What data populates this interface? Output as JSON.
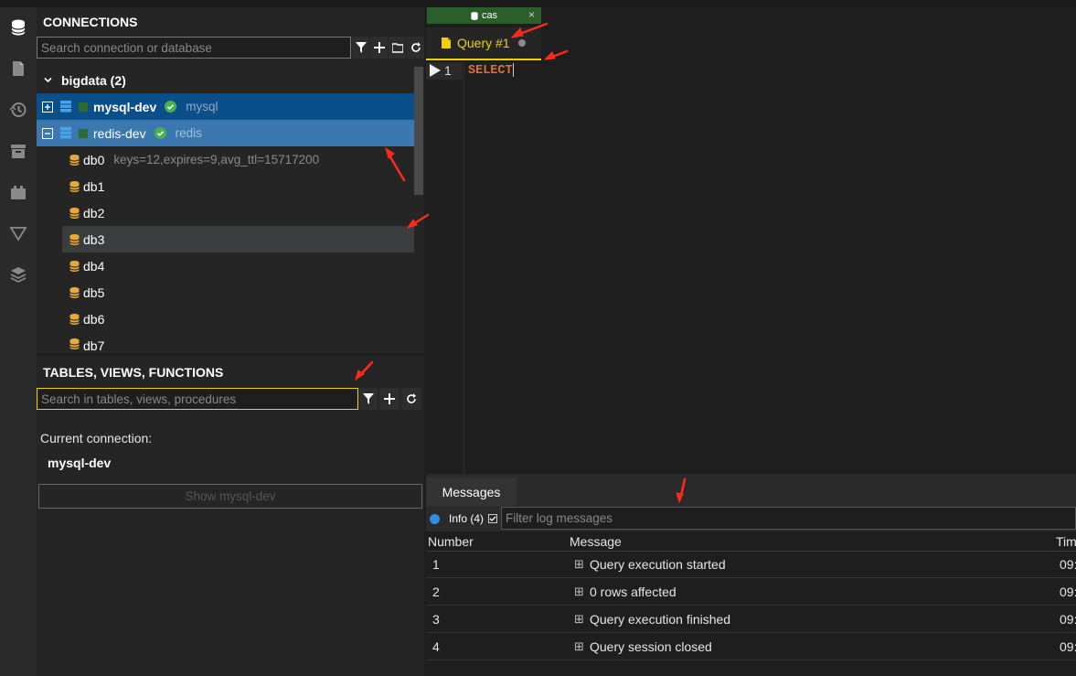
{
  "sidebar_icons": [
    "database-icon",
    "file-icon",
    "history-icon",
    "archive-icon",
    "plugin-icon",
    "filter-icon",
    "layers-icon"
  ],
  "connections": {
    "title": "CONNECTIONS",
    "search_placeholder": "Search connection or database",
    "group": "bigdata (2)",
    "items": [
      {
        "name": "mysql-dev",
        "type": "mysql"
      },
      {
        "name": "redis-dev",
        "type": "redis"
      }
    ],
    "databases": [
      {
        "name": "db0",
        "info": "keys=12,expires=9,avg_ttl=15717200"
      },
      {
        "name": "db1",
        "info": ""
      },
      {
        "name": "db2",
        "info": ""
      },
      {
        "name": "db3",
        "info": ""
      },
      {
        "name": "db4",
        "info": ""
      },
      {
        "name": "db5",
        "info": ""
      },
      {
        "name": "db6",
        "info": ""
      },
      {
        "name": "db7",
        "info": ""
      }
    ]
  },
  "tables": {
    "title": "TABLES, VIEWS, FUNCTIONS",
    "search_placeholder": "Search in tables, views, procedures",
    "current_label": "Current connection:",
    "current_value": "mysql-dev",
    "show_button": "Show mysql-dev"
  },
  "editor": {
    "file_tab": "cas",
    "query_tab": "Query #1",
    "line_number": "1",
    "code": "SELECT"
  },
  "messages": {
    "tab": "Messages",
    "info_label": "Info (4)",
    "filter_placeholder": "Filter log messages",
    "columns": [
      "Number",
      "Message",
      "Tim"
    ],
    "rows": [
      {
        "number": "1",
        "message": "Query execution started",
        "time": "09:"
      },
      {
        "number": "2",
        "message": "0 rows affected",
        "time": "09:"
      },
      {
        "number": "3",
        "message": "Query execution finished",
        "time": "09:"
      },
      {
        "number": "4",
        "message": "Query session closed",
        "time": "09:"
      }
    ]
  },
  "colors": {
    "accent": "#f0d000",
    "selected": "#0a4f8a",
    "selected2": "#3b78b0",
    "keyword": "#e0712d",
    "success": "#4caf50"
  }
}
